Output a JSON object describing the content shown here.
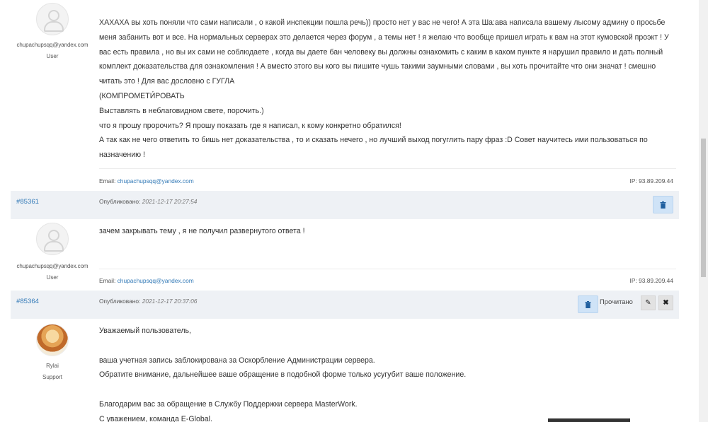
{
  "posts": [
    {
      "author": {
        "email": "chupachupsqq@yandex.com",
        "role": "User",
        "avatar": "default-user-icon"
      },
      "paragraphs": [
        "ХАХАХА вы хоть поняли что сами написали , о какой инспекции пошла речь)) просто нет у вас не чего! А эта Ша:ава написала вашему лысому админу о просьбе меня забанить вот и все. На нормальных серверах это делается через форум , а темы нет ! я желаю что вообще пришел играть к вам на этот кумовской проэкт ! У вас есть правила , но вы их сами не соблюдаете , когда вы даете бан человеку вы должны ознакомить с каким в каком пункте я нарушил правило и дать полный комплект доказательства для ознакомления ! А вместо этого  вы кого вы пишите чушь  такими заумными словами , вы хоть прочитайте что они значат ! смешно читать это ! Для вас дословно с ГУГЛА",
        "(КОМПРОМЕТИ́РОВАТЬ",
        "Выставлять в неблаговидном свете, порочить.)",
        "что я прошу пророчить? Я  прошу показать где я написал, к кому конкретно обратился!",
        "А так как не чего ответить то бишь нет доказательства , то и сказать нечего , но лучший выход погуглить пару фраз :D Совет научитесь ими пользоваться по назначению !"
      ],
      "footer": {
        "email_label": "Email:",
        "email": "chupachupsqq@yandex.com",
        "ip": "IP: 93.89.209.44"
      }
    },
    {
      "meta": {
        "id": "#85361",
        "published_label": "Опубликовано:",
        "published_at": "2021-12-17 20:27:54"
      },
      "author": {
        "email": "chupachupsqq@yandex.com",
        "role": "User",
        "avatar": "default-user-icon"
      },
      "paragraphs": [
        "зачем закрывать тему , я не получил развернутого ответа !"
      ],
      "footer": {
        "email_label": "Email:",
        "email": "chupachupsqq@yandex.com",
        "ip": "IP: 93.89.209.44"
      }
    },
    {
      "meta": {
        "id": "#85364",
        "published_label": "Опубликовано:",
        "published_at": "2021-12-17 20:37:06",
        "read_label": "Прочитано"
      },
      "author": {
        "name": "Rylai",
        "role": "Support",
        "avatar": "rylai-avatar"
      },
      "paragraphs": [
        "Уважаемый пользователь,",
        "",
        "ваша учетная запись заблокирована за Оскорбление Администрации сервера.",
        "Обратите внимание, дальнейшее ваше обращение в подобной форме только усугубит ваше положение.",
        "",
        "Благодарим вас за обращение в Службу Поддержки сервера  MasterWork.",
        "С уважением, команда E-Global."
      ]
    }
  ],
  "icons": {
    "delete": "trash-icon",
    "edit": "edit-icon",
    "close": "close-icon"
  },
  "colors": {
    "link": "#337ab7",
    "meta_bar": "#eef1f5",
    "delete_button": "#cfe3f7"
  }
}
